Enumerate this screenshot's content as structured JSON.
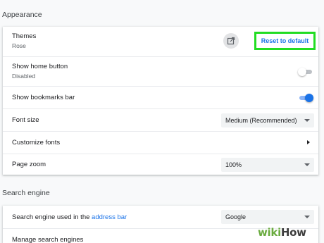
{
  "appearance": {
    "section_title": "Appearance",
    "themes": {
      "label": "Themes",
      "value": "Rose",
      "reset_label": "Reset to default",
      "open_icon": "open-in-new-icon"
    },
    "home_button": {
      "label": "Show home button",
      "value": "Disabled",
      "on": false
    },
    "bookmarks_bar": {
      "label": "Show bookmarks bar",
      "on": true
    },
    "font_size": {
      "label": "Font size",
      "selected": "Medium (Recommended)"
    },
    "customize_fonts": {
      "label": "Customize fonts"
    },
    "page_zoom": {
      "label": "Page zoom",
      "selected": "100%"
    }
  },
  "search_engine": {
    "section_title": "Search engine",
    "used_in": {
      "label_prefix": "Search engine used in the ",
      "link": "address bar",
      "selected": "Google"
    },
    "manage": {
      "label": "Manage search engines"
    }
  },
  "watermark": {
    "part1": "wiki",
    "part2": "How"
  },
  "colors": {
    "accent": "#1a73e8",
    "highlight": "#22dd22",
    "toggle_on_track": "#8ab4f8"
  }
}
